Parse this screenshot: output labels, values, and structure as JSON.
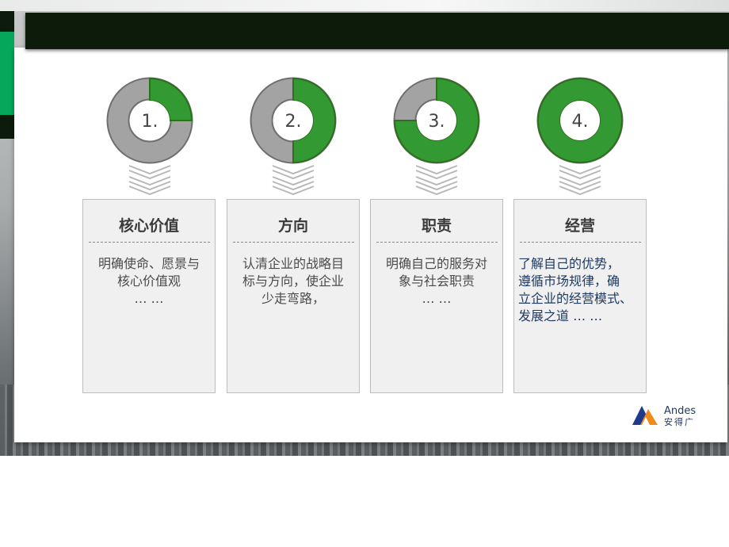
{
  "slide": {
    "title": ""
  },
  "steps": [
    {
      "number": "1.",
      "progress": 0.25,
      "heading": "核心价值",
      "text": "明确使命、愿景与\n核心价值观\n… …",
      "text_color": "#4a4a4a"
    },
    {
      "number": "2.",
      "progress": 0.5,
      "heading": "方向",
      "text": "认清企业的战略目\n标与方向，使企业\n少走弯路，",
      "text_color": "#4a4a4a"
    },
    {
      "number": "3.",
      "progress": 0.75,
      "heading": "职责",
      "text": "明确自己的服务对\n象与社会职责\n… …",
      "text_color": "#4a4a4a"
    },
    {
      "number": "4.",
      "progress": 1.0,
      "heading": "经营",
      "text": "了解自己的优势，\n遵循市场规律，确\n立企业的经营模式、\n   发展之道  … …",
      "text_color": "#1f3a63"
    }
  ],
  "colors": {
    "accent_green": "#339933",
    "ring_grey": "#9a9a9a",
    "title_bar": "#0c1b0a",
    "side_green": "#05a85a"
  },
  "logo": {
    "name_en": "Andes",
    "name_cn": "安得广",
    "icon": "andes-logo-icon"
  }
}
